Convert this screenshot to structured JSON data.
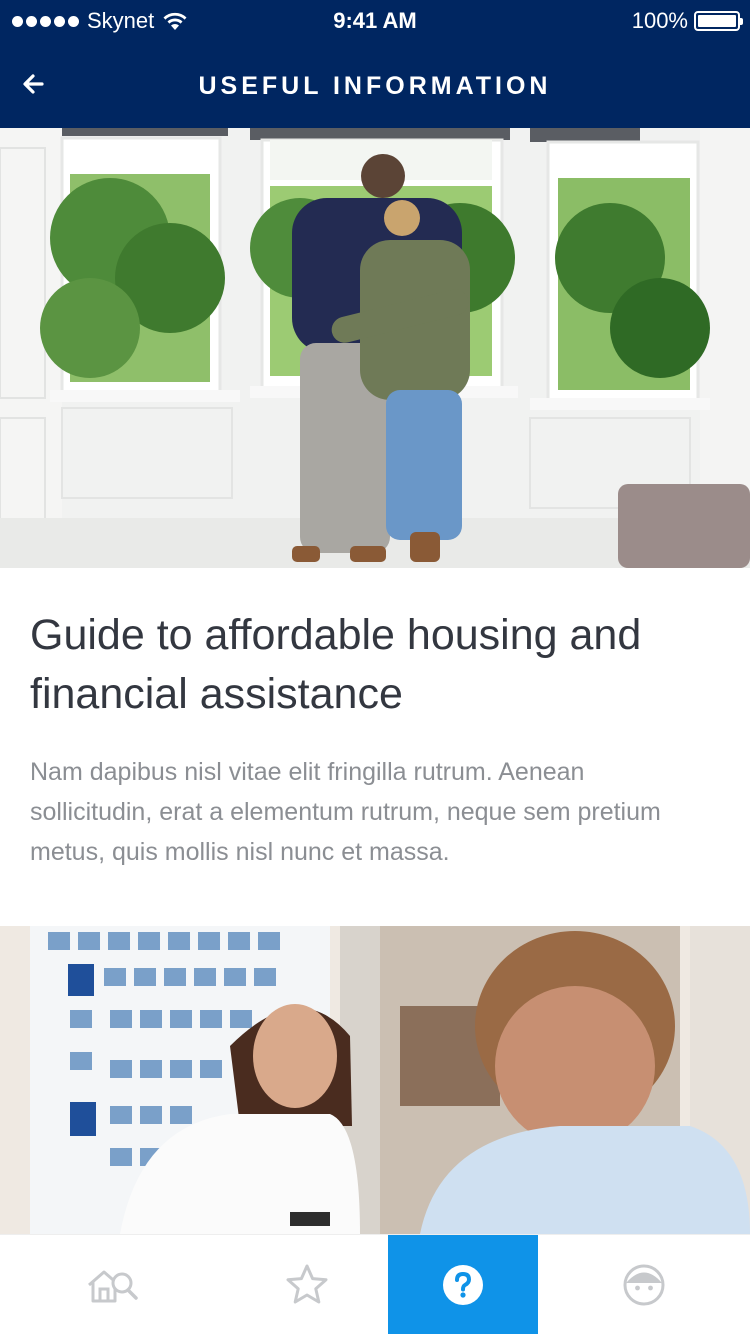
{
  "status_bar": {
    "carrier": "Skynet",
    "time": "9:41 AM",
    "battery": "100%"
  },
  "nav": {
    "title": "USEFUL INFORMATION",
    "back_icon": "back-arrow-icon"
  },
  "article": {
    "title": "Guide to affordable housing and financial assistance",
    "body": "Nam dapibus nisl vitae elit fringilla rutrum. Aenean sollicitudin, erat a elementum rutrum, neque sem pretium metus, quis mollis nisl nunc et massa."
  },
  "tabs": [
    {
      "icon": "home-search-icon",
      "active": false
    },
    {
      "icon": "star-icon",
      "active": false
    },
    {
      "icon": "question-icon",
      "active": true
    },
    {
      "icon": "profile-icon",
      "active": false
    }
  ],
  "colors": {
    "nav_background": "#002661",
    "active_tab": "#0f93e8",
    "title_text": "#333740",
    "body_text": "#8b8e93"
  }
}
